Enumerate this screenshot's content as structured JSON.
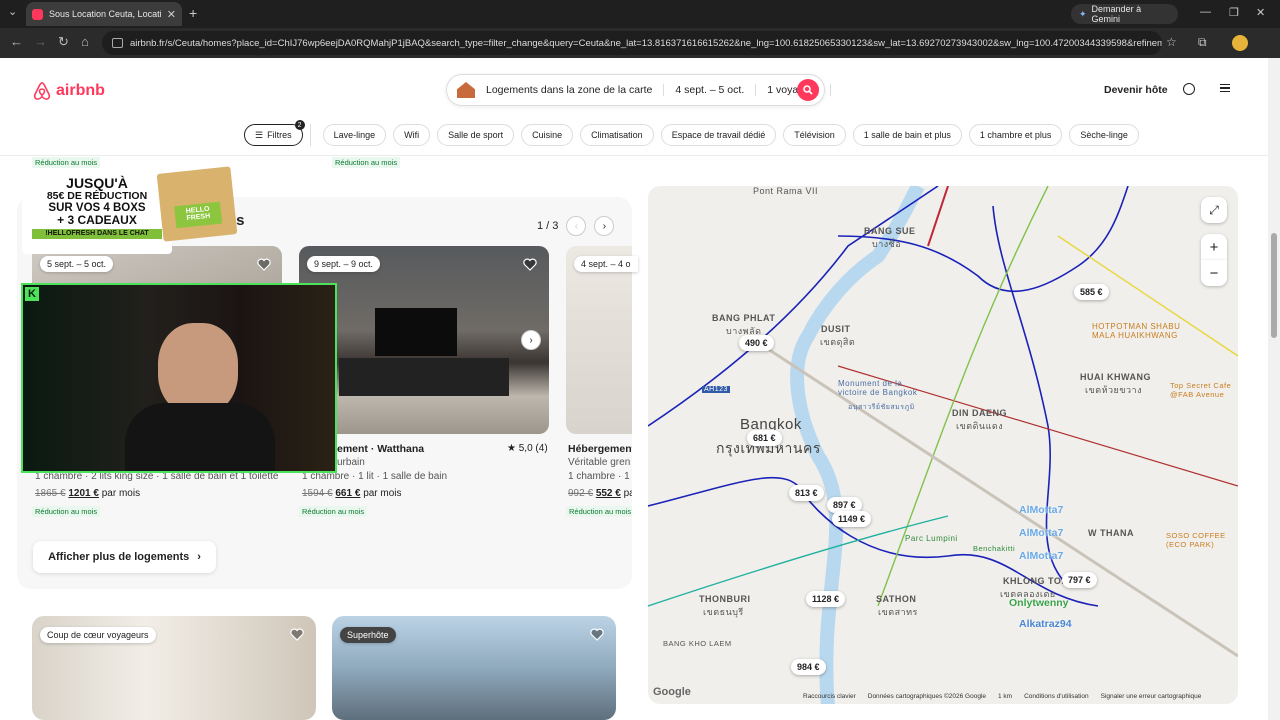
{
  "browser": {
    "tab_title": "Sous Location Ceuta, Location d",
    "gemini_label": "Demander à Gemini",
    "url": "airbnb.fr/s/Ceuta/homes?place_id=ChIJ76wp6eejDA0RQMahjP1jBAQ&search_type=filter_change&query=Ceuta&ne_lat=13.816371616615262&ne_lng=100.61825065330123&sw_lat=13.69270273943002&sw_lng=100.47200344339598&refinement_..."
  },
  "header": {
    "logo": "airbnb",
    "search_zone": "Logements dans la zone de la carte",
    "search_dates": "4 sept. – 5 oct.",
    "search_guests": "1 voyageur",
    "host_link": "Devenir hôte"
  },
  "filters": {
    "filters_label": "Filtres",
    "filters_count": "2",
    "chips": [
      "Lave-linge",
      "Wifi",
      "Salle de sport",
      "Cuisine",
      "Climatisation",
      "Espace de travail dédié",
      "Télévision",
      "1 salle de bain et plus",
      "1 chambre et plus",
      "Sèche-linge"
    ]
  },
  "top_badges": [
    "Réduction au mois",
    "Réduction au mois"
  ],
  "section": {
    "title_fragment": "res",
    "pager": "1 / 3",
    "show_more": "Afficher plus de logements",
    "cards": [
      {
        "dates": "5 sept. – 5 oct.",
        "details": "1 chambre · 2 lits king size · 1 salle de bain et 1 toilette",
        "old_price": "1865 €",
        "price": "1201 €",
        "per": "par mois",
        "badge": "Réduction au mois"
      },
      {
        "dates": "9 sept. – 9 oct.",
        "title": "ement · Watthana",
        "rating": "5,0 (4)",
        "subtitle": "urbain",
        "details": "1 chambre · 1 lit · 1 salle de bain",
        "old_price": "1594 €",
        "price": "661 €",
        "per": "par mois",
        "badge": "Réduction au mois"
      },
      {
        "dates": "4 sept. – 4 o",
        "title": "Hébergement",
        "subtitle": "Véritable gren",
        "details": "1 chambre · 1 li",
        "old_price": "992 €",
        "price": "552 €",
        "per": "par mois",
        "badge": "Réduction au mois"
      }
    ]
  },
  "ad": {
    "line1": "JUSQU'À",
    "line2": "85€ DE RÉDUCTION",
    "line3": "SUR VOS 4 BOXS",
    "line4": "+ 3 CADEAUX",
    "line5": "!HELLOFRESH DANS LE CHAT",
    "brand": "HELLO FRESH"
  },
  "bottom_cards": [
    {
      "badge": "Coup de cœur voyageurs"
    },
    {
      "badge": "Superhôte"
    }
  ],
  "map": {
    "labels": [
      "Pont Rama VII",
      "BANG SUE",
      "บางซื่อ",
      "BANG PHLAT",
      "บางพลัด",
      "DUSIT",
      "เขตดุสิต",
      "Monument de la victoire de Bangkok",
      "อนุสาวรีย์ชัยสมรภูมิ",
      "Bangkok",
      "กรุงเทพมหานคร",
      "DIN DAENG",
      "เขตดินแดง",
      "HUAI KHWANG",
      "เขตห้วยขวาง",
      "HOTPOTMAN SHABU MALA HUAIKHWANG",
      "Top Secret Cafe @FAB Avenue",
      "THONBURI",
      "เขตธนบุรี",
      "SATHON",
      "เขตสาทร",
      "KHLONG TOEI",
      "เขตคลองเตย",
      "W THANA",
      "SOSO COFFEE (ECO PARK)",
      "Parc Lumpini",
      "Benchakitti",
      "BANG KHO LAEM",
      "AH123"
    ],
    "prices": [
      "585 €",
      "490 €",
      "681 €",
      "813 €",
      "897 €",
      "1149 €",
      "1128 €",
      "984 €",
      "797 €"
    ],
    "chat_overlay": [
      "AlMotta7",
      "AlMotta7",
      "AlMotta7",
      "Onlytwenny",
      "Alkatraz94"
    ],
    "footer": [
      "Raccourcis clavier",
      "Données cartographiques ©2026 Google",
      "1 km",
      "Conditions d'utilisation",
      "Signaler une erreur cartographique"
    ],
    "google": "Google"
  },
  "colors": {
    "brand": "#ff385c",
    "discount": "#0a7a2f",
    "stream_border": "#4ce35a"
  }
}
